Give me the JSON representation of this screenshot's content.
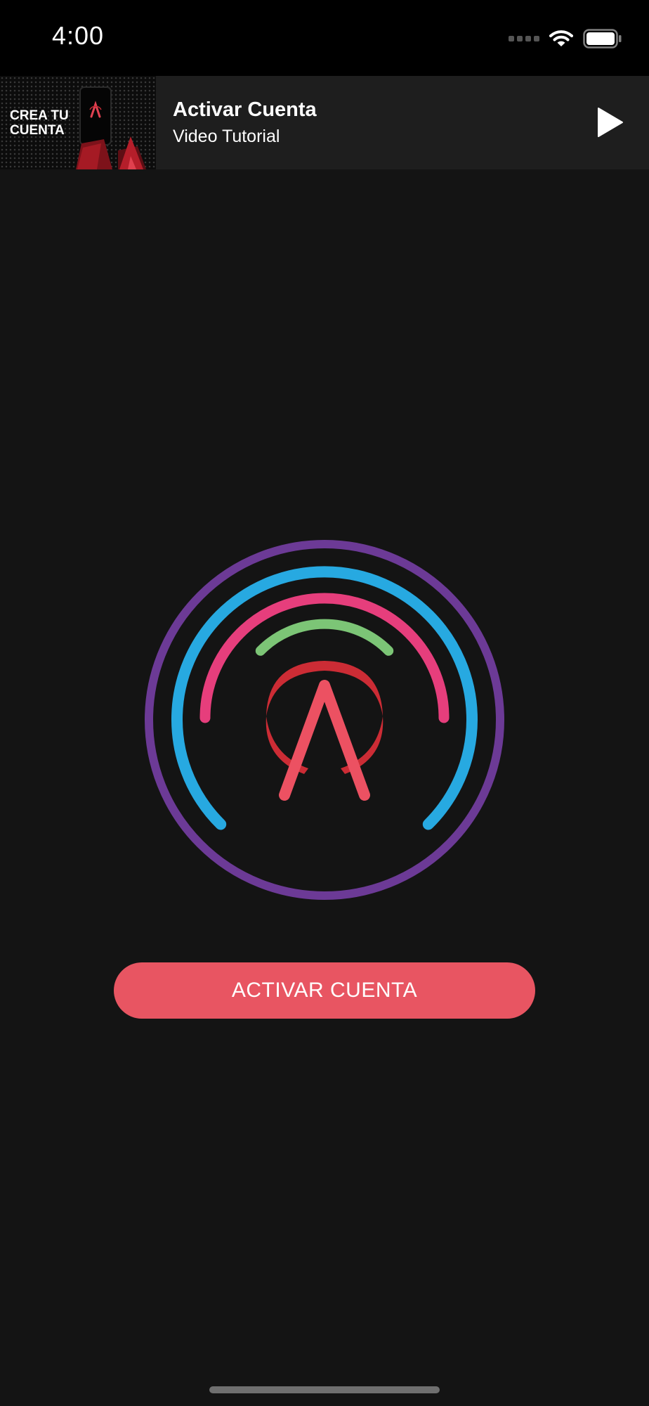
{
  "status_bar": {
    "time": "4:00"
  },
  "video_banner": {
    "thumbnail_text": "CREA TU CUENTA",
    "thumbnail_logo_letter": "A",
    "title": "Activar Cuenta",
    "subtitle": "Video Tutorial",
    "play_icon": "play-icon"
  },
  "logo": {
    "letter": "A",
    "ring_colors": {
      "outer": "#6c3a96",
      "second": "#27a9e1",
      "third": "#e63e7c",
      "inner": "#7cc576",
      "crescent": "#cc2c35",
      "letter": "#ec5162"
    }
  },
  "main": {
    "activate_button_label": "ACTIVAR CUENTA"
  },
  "colors": {
    "background": "#141414",
    "banner": "#1e1e1e",
    "button": "#e85562"
  }
}
